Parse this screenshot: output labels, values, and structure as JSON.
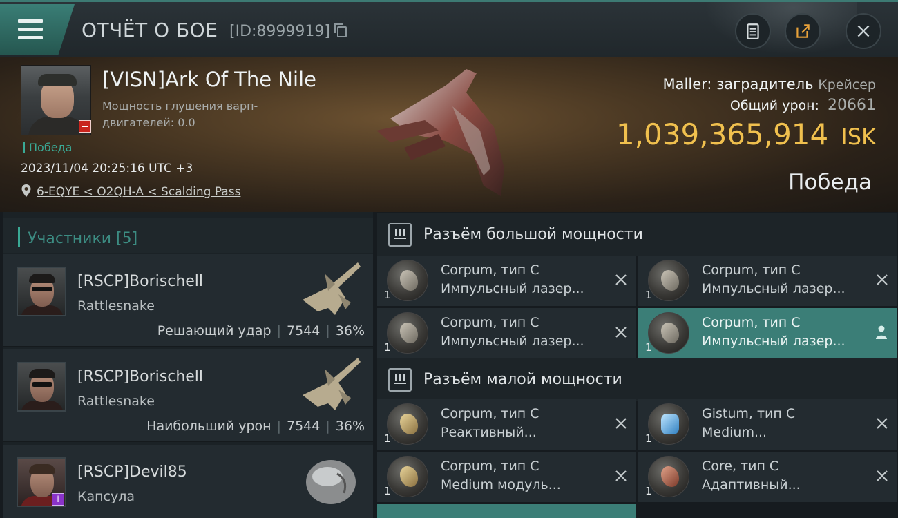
{
  "header": {
    "title": "ОТЧЁТ О БОЕ",
    "report_id": "[ID:8999919]"
  },
  "victim": {
    "name": "[VISN]Ark Of The Nile",
    "warp_label": "Мощность глушения варп-двигателей: 0.0",
    "status": "Победа",
    "datetime": "2023/11/04 20:25:16 UTC +3",
    "location": "6-EQYE < O2QH-A < Scalding Pass",
    "ship": "Maller: заградитель",
    "ship_class": "Крейсер",
    "damage_label": "Общий урон:",
    "damage_value": "20661",
    "isk_value": "1,039,365,914",
    "isk_currency": "ISK",
    "result": "Победа"
  },
  "participants": {
    "title": "Участники [5]",
    "items": [
      {
        "name": "[RSCP]Borischell",
        "ship": "Rattlesnake",
        "role": "Решающий удар",
        "damage": "7544",
        "percent": "36%"
      },
      {
        "name": "[RSCP]Borischell",
        "ship": "Rattlesnake",
        "role": "Наибольший урон",
        "damage": "7544",
        "percent": "36%"
      },
      {
        "name": "[RSCP]Devil85",
        "ship": "Капсула"
      }
    ]
  },
  "slots": {
    "high": {
      "title": "Разъём большой мощности",
      "modules": [
        {
          "name": "Corpum, тип C",
          "desc": "Импульсный лазер...",
          "qty": "1",
          "icon": "pulse-laser-icon"
        },
        {
          "name": "Corpum, тип C",
          "desc": "Импульсный лазер...",
          "qty": "1",
          "icon": "pulse-laser-icon"
        },
        {
          "name": "Corpum, тип C",
          "desc": "Импульсный лазер...",
          "qty": "1",
          "icon": "pulse-laser-icon"
        },
        {
          "name": "Corpum, тип C",
          "desc": "Импульсный лазер...",
          "qty": "1",
          "icon": "pulse-laser-icon"
        }
      ]
    },
    "low": {
      "title": "Разъём малой мощности",
      "modules": [
        {
          "name": "Corpum, тип C",
          "desc": "Реактивный...",
          "qty": "1",
          "icon": "reactive-armor-icon"
        },
        {
          "name": "Gistum, тип C",
          "desc": "Medium...",
          "qty": "1",
          "icon": "shield-extender-icon"
        },
        {
          "name": "Corpum, тип C",
          "desc": "Medium модуль...",
          "qty": "1",
          "icon": "armor-module-icon"
        },
        {
          "name": "Core, тип C",
          "desc": "Адаптивный...",
          "qty": "1",
          "icon": "adaptive-plating-icon"
        }
      ]
    }
  },
  "colors": {
    "accent": "#3aa995",
    "active_row": "#3b7e77",
    "isk": "#f0c04e",
    "minus_badge": "#c9241d",
    "info_badge": "#8a33c9"
  }
}
